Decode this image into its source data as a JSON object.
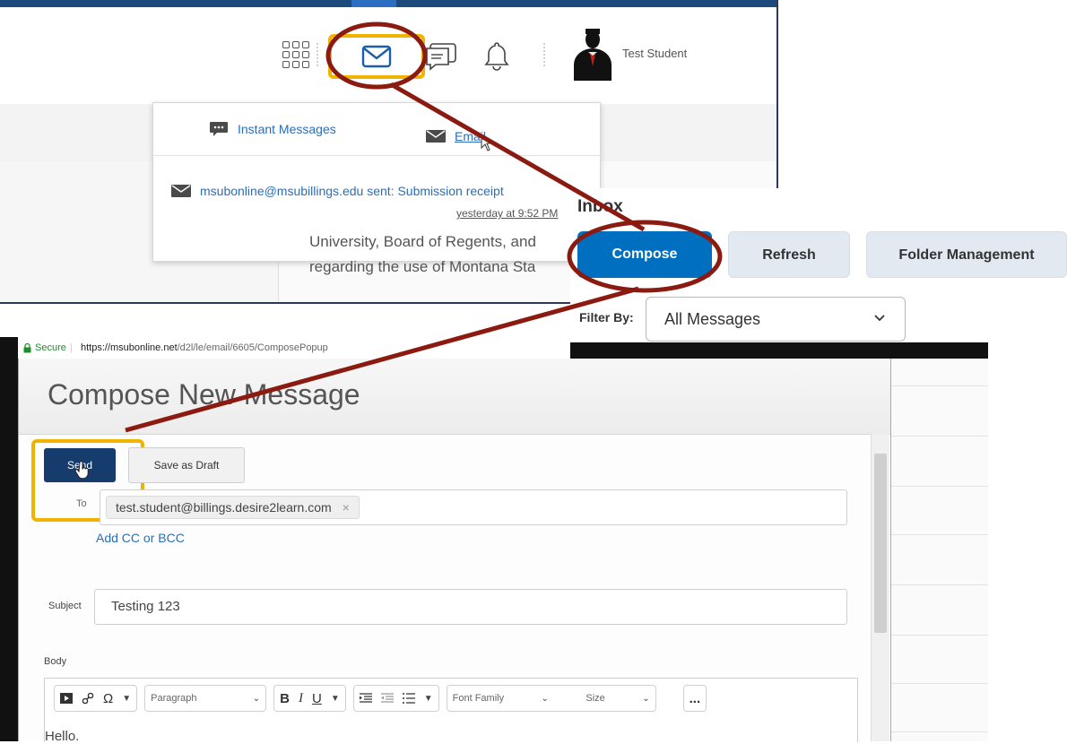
{
  "header": {
    "user_name": "Test Student"
  },
  "messages_popup": {
    "tab_instant": "Instant Messages",
    "tab_email": "Email",
    "message_text": "msubonline@msubillings.edu sent: Submission receipt",
    "message_time": "yesterday at 9:52 PM",
    "background_text_line1": "University, Board of Regents, and",
    "background_text_line2": "regarding the use of Montana Sta"
  },
  "inbox": {
    "title": "Inbox",
    "compose_label": "Compose",
    "refresh_label": "Refresh",
    "folder_label": "Folder Management",
    "filter_label": "Filter By:",
    "filter_value": "All Messages"
  },
  "browser": {
    "secure_label": "Secure",
    "url_host": "https://msubonline.net",
    "url_path": "/d2l/le/email/6605/ComposePopup"
  },
  "compose": {
    "title": "Compose New Message",
    "send_label": "Send",
    "draft_label": "Save as Draft",
    "to_label": "To",
    "to_value": "test.student@billings.desire2learn.com",
    "to_remove": "×",
    "add_cc": "Add CC or BCC",
    "subject_label": "Subject",
    "subject_value": "Testing 123",
    "body_label": "Body",
    "paragraph_select": "Paragraph",
    "bold": "B",
    "italic": "I",
    "underline": "U",
    "font_family_select": "Font Family",
    "size_select": "Size",
    "more": "...",
    "body_text": "Hello."
  },
  "colors": {
    "annotation_arrow": "#8b1a10",
    "highlight_box": "#f0b400",
    "compose_button": "#006fbf",
    "send_button": "#163b6d",
    "link": "#2a6ebb"
  }
}
